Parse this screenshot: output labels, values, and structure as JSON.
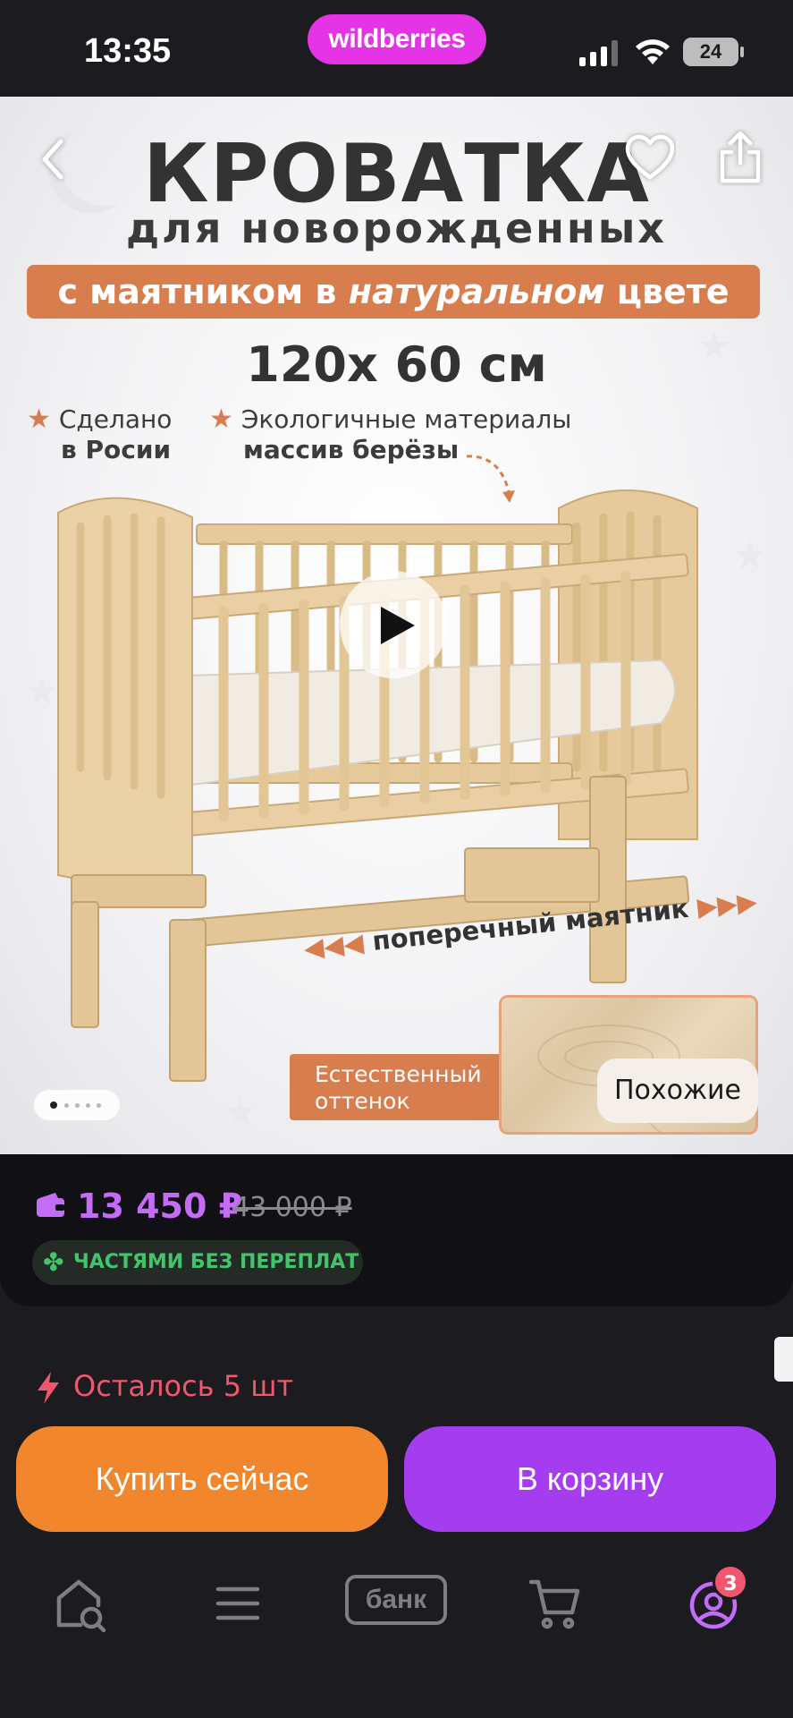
{
  "status_bar": {
    "time": "13:35",
    "brand": "wildberries",
    "battery": "24"
  },
  "hero": {
    "title": "КРОВАТКА",
    "subtitle": "для новорожденных",
    "ribbon_pre": "с маятником в ",
    "ribbon_em": "натуральном",
    "ribbon_post": " цвете",
    "size": "120x 60 см",
    "feature1_line1": "Сделано",
    "feature1_line2": "в Росии",
    "feature2_line1": "Экологичные материалы",
    "feature2_line2": "массив берёзы",
    "pendulum": "поперечный маятник",
    "tone_line1": "Естественный",
    "tone_line2": "оттенок",
    "similar_button": "Похожие",
    "carousel": {
      "total": 5,
      "active": 1
    }
  },
  "price": {
    "current": "13 450 ₽",
    "old": "43 000 ₽",
    "installments": "ЧАСТЯМИ БЕЗ ПЕРЕПЛАТ"
  },
  "actions": {
    "stock": "Осталось 5 шт",
    "buy_now": "Купить сейчас",
    "to_cart": "В корзину"
  },
  "nav": {
    "bank": "банк",
    "profile_badge": "3"
  },
  "colors": {
    "background": "#1c1b20",
    "brand": "#e533e6",
    "price": "#c36cf5",
    "accent_orange": "#f1862c",
    "accent_purple": "#a63cf0",
    "stock_red": "#f0566c",
    "installments_green": "#44c46a",
    "ribbon": "#d87d4d"
  },
  "icons": [
    "back-icon",
    "heart-icon",
    "share-icon",
    "wallet-icon",
    "clover-icon",
    "lightning-icon",
    "home-search-icon",
    "menu-icon",
    "cart-icon",
    "profile-icon",
    "play-icon"
  ]
}
